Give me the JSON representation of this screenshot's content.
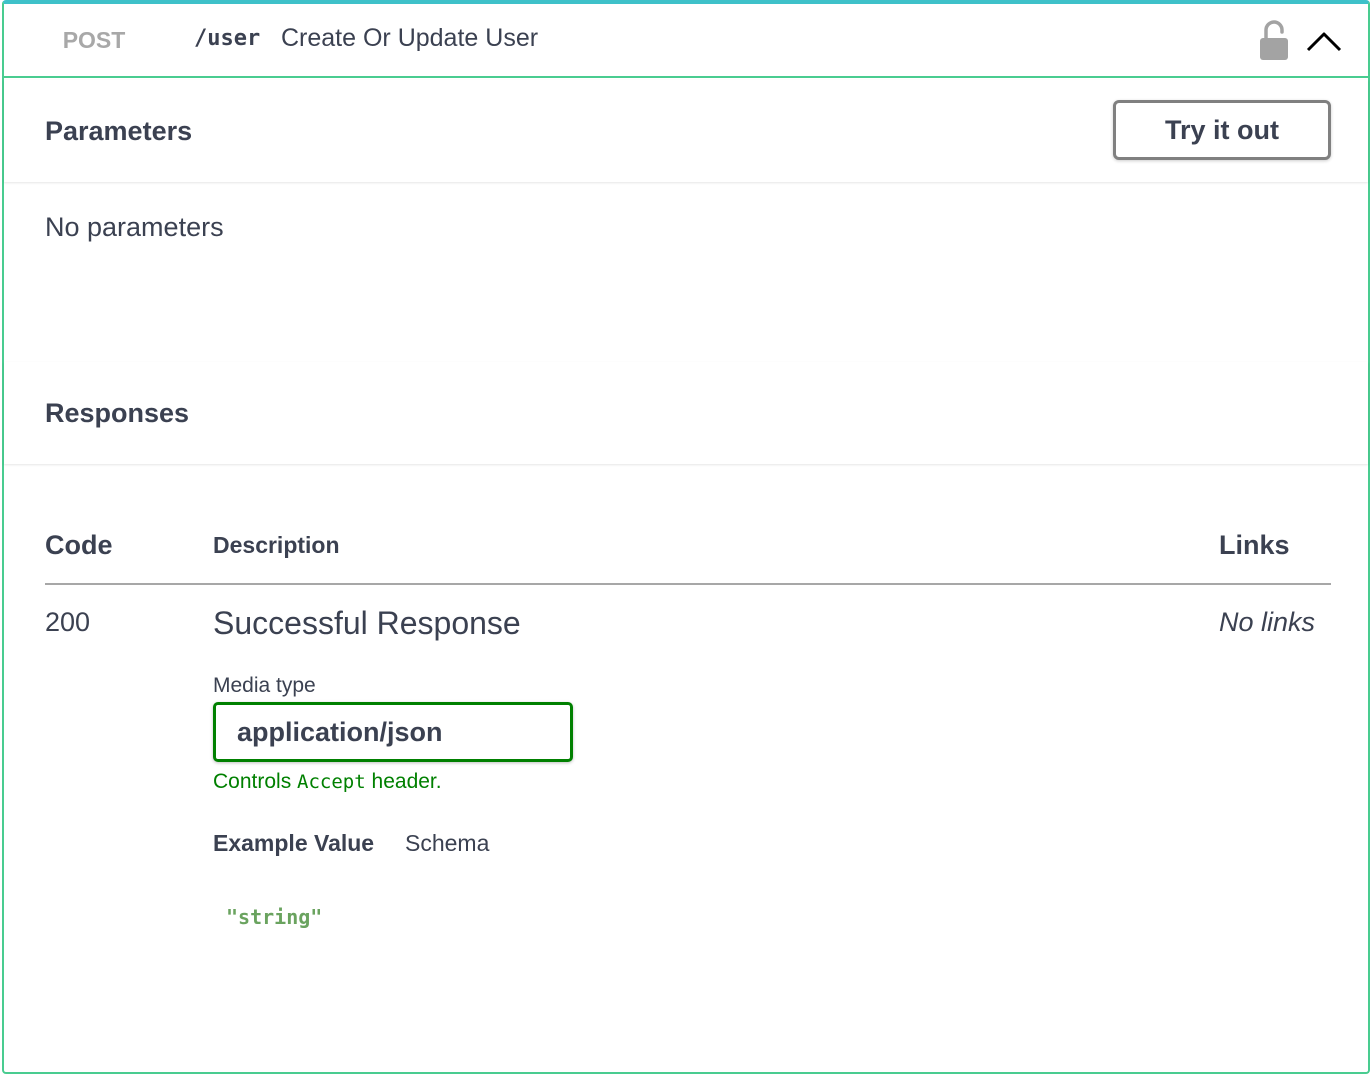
{
  "operation": {
    "method": "POST",
    "path": "/user",
    "summary": "Create Or Update User"
  },
  "icons": {
    "lock": "lock-open-icon",
    "collapse": "chevron-up-icon"
  },
  "parameters": {
    "title": "Parameters",
    "try_label": "Try it out",
    "empty_text": "No parameters"
  },
  "responses": {
    "title": "Responses",
    "columns": {
      "code": "Code",
      "description": "Description",
      "links": "Links"
    },
    "rows": [
      {
        "code": "200",
        "description": "Successful Response",
        "links": "No links",
        "media_type_label": "Media type",
        "media_type": "application/json",
        "controls_prefix": "Controls",
        "controls_code": "Accept",
        "controls_suffix": "header.",
        "tabs": {
          "example": "Example Value",
          "schema": "Schema"
        },
        "example": "\"string\""
      }
    ]
  },
  "colors": {
    "post": "#49cc90",
    "accent_top": "#3ec1c9",
    "method_text": "#a8a8a8",
    "media_border": "#008000",
    "example_text": "#6aa35f"
  }
}
